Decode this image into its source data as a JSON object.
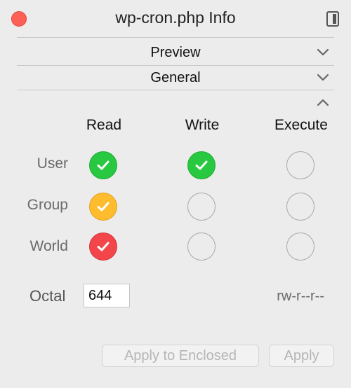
{
  "window": {
    "title": "wp-cron.php Info"
  },
  "sections": {
    "preview": {
      "label": "Preview"
    },
    "general": {
      "label": "General"
    }
  },
  "permissions": {
    "columns": [
      "Read",
      "Write",
      "Execute"
    ],
    "rows": [
      {
        "label": "User",
        "read": true,
        "write": true,
        "execute": false
      },
      {
        "label": "Group",
        "read": true,
        "write": false,
        "execute": false
      },
      {
        "label": "World",
        "read": true,
        "write": false,
        "execute": false
      }
    ],
    "colors": {
      "user": "#28c840",
      "group": "#febc2e",
      "world": "#f2464a"
    },
    "octal_label": "Octal",
    "octal_value": "644",
    "symbolic": "rw-r--r--"
  },
  "buttons": {
    "apply_enclosed": "Apply to Enclosed",
    "apply": "Apply"
  }
}
